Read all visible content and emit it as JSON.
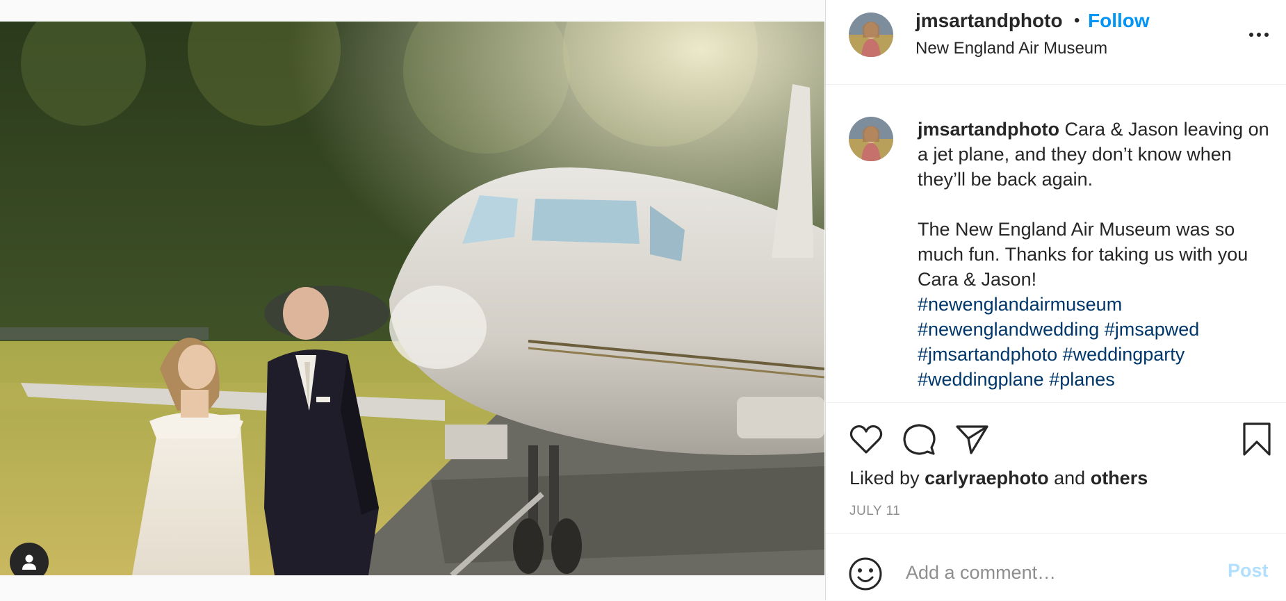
{
  "post": {
    "image_alt": "Bride and groom walking beside a white jet plane",
    "username": "jmsartandphoto",
    "follow_label": "Follow",
    "separator": "•",
    "location": "New England Air Museum"
  },
  "caption": {
    "username": "jmsartandphoto",
    "line1": " Cara & Jason leaving on a jet plane, and they don’t know when they’ll be back again.",
    "line2": "The New England Air Museum was so much fun. Thanks for taking us with you Cara & Jason!",
    "hashtags": [
      "#newenglandairmuseum",
      "#newenglandwedding",
      "#jmsapwed",
      "#jmsartandphoto",
      "#weddingparty",
      "#weddingplane",
      "#planes"
    ]
  },
  "likes": {
    "prefix": "Liked by ",
    "user": "carlyraephoto",
    "middle": " and ",
    "suffix": "others"
  },
  "date": "JULY 11",
  "comment": {
    "placeholder": "Add a comment…",
    "post_label": "Post"
  },
  "icons": {
    "like": "heart-icon",
    "comment": "comment-icon",
    "share": "paper-plane-icon",
    "save": "bookmark-icon",
    "emoji": "smiley-icon",
    "more": "ellipsis-icon",
    "tag": "user-tag-icon"
  },
  "colors": {
    "follow": "#0095f6",
    "hashtag": "#00376b",
    "post_disabled": "#b2dffc",
    "muted": "#8e8e8e"
  }
}
